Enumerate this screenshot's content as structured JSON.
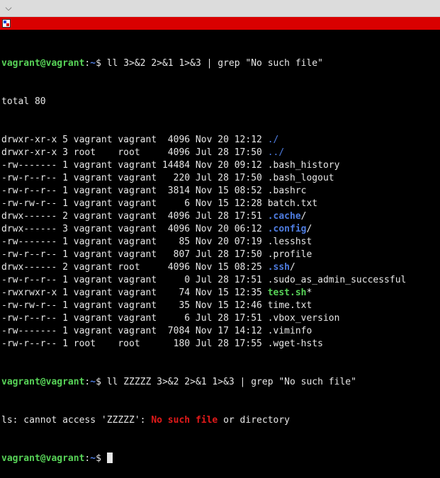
{
  "prompt": {
    "user_host": "vagrant@vagrant",
    "sep": ":",
    "path": "~",
    "symbol": "$ "
  },
  "commands": {
    "first": "ll 3>&2 2>&1 1>&3 | grep \"No such file\"",
    "second": "ll ZZZZZ 3>&2 2>&1 1>&3 | grep \"No such file\""
  },
  "total_line": "total 80",
  "listing": [
    {
      "meta": "drwxr-xr-x 5 vagrant vagrant  4096 Nov 20 12:12 ",
      "name": "./",
      "name_style": "dirplain",
      "suffix": ""
    },
    {
      "meta": "drwxr-xr-x 3 root    root     4096 Jul 28 17:50 ",
      "name": "../",
      "name_style": "dirplain",
      "suffix": ""
    },
    {
      "meta": "-rw------- 1 vagrant vagrant 14484 Nov 20 09:12 ",
      "name": ".bash_history",
      "name_style": "",
      "suffix": ""
    },
    {
      "meta": "-rw-r--r-- 1 vagrant vagrant   220 Jul 28 17:50 ",
      "name": ".bash_logout",
      "name_style": "",
      "suffix": ""
    },
    {
      "meta": "-rw-r--r-- 1 vagrant vagrant  3814 Nov 15 08:52 ",
      "name": ".bashrc",
      "name_style": "",
      "suffix": ""
    },
    {
      "meta": "-rw-rw-r-- 1 vagrant vagrant     6 Nov 15 12:28 ",
      "name": "batch.txt",
      "name_style": "",
      "suffix": ""
    },
    {
      "meta": "drwx------ 2 vagrant vagrant  4096 Jul 28 17:51 ",
      "name": ".cache",
      "name_style": "dir",
      "suffix": "/"
    },
    {
      "meta": "drwx------ 3 vagrant vagrant  4096 Nov 20 06:12 ",
      "name": ".config",
      "name_style": "dir",
      "suffix": "/"
    },
    {
      "meta": "-rw------- 1 vagrant vagrant    85 Nov 20 07:19 ",
      "name": ".lesshst",
      "name_style": "",
      "suffix": ""
    },
    {
      "meta": "-rw-r--r-- 1 vagrant vagrant   807 Jul 28 17:50 ",
      "name": ".profile",
      "name_style": "",
      "suffix": ""
    },
    {
      "meta": "drwx------ 2 vagrant root     4096 Nov 15 08:25 ",
      "name": ".ssh",
      "name_style": "dir",
      "suffix": "/"
    },
    {
      "meta": "-rw-r--r-- 1 vagrant vagrant     0 Jul 28 17:51 ",
      "name": ".sudo_as_admin_successful",
      "name_style": "",
      "suffix": ""
    },
    {
      "meta": "-rwxrwxr-x 1 vagrant vagrant    74 Nov 15 12:35 ",
      "name": "test.sh",
      "name_style": "exec",
      "suffix": "*"
    },
    {
      "meta": "-rw-rw-r-- 1 vagrant vagrant    35 Nov 15 12:46 ",
      "name": "time.txt",
      "name_style": "",
      "suffix": ""
    },
    {
      "meta": "-rw-r--r-- 1 vagrant vagrant     6 Jul 28 17:51 ",
      "name": ".vbox_version",
      "name_style": "",
      "suffix": ""
    },
    {
      "meta": "-rw------- 1 vagrant vagrant  7084 Nov 17 14:12 ",
      "name": ".viminfo",
      "name_style": "",
      "suffix": ""
    },
    {
      "meta": "-rw-r--r-- 1 root    root      180 Jul 28 17:55 ",
      "name": ".wget-hsts",
      "name_style": "",
      "suffix": ""
    }
  ],
  "error_line": {
    "before": "ls: cannot access 'ZZZZZ': ",
    "match": "No such file",
    "after": " or directory"
  },
  "icons": {
    "menu": "chevron-down-icon",
    "tab": "terminal-tab-icon"
  },
  "colors": {
    "tab_bar": "#d90000",
    "prompt_user": "#58d458",
    "path": "#4e7ce0",
    "grep_match": "#e21a1a"
  }
}
